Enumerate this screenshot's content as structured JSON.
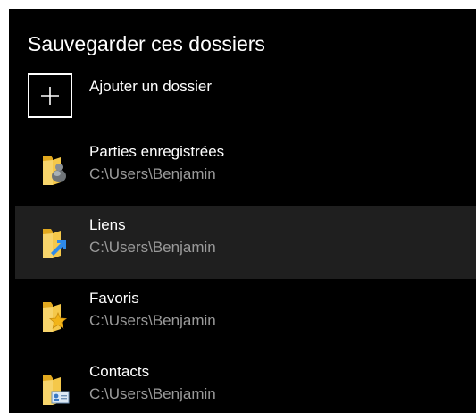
{
  "section": {
    "title": "Sauvegarder ces dossiers",
    "add_label": "Ajouter un dossier"
  },
  "folders": [
    {
      "name": "Parties enregistrées",
      "path": "C:\\Users\\Benjamin",
      "icon": "saved-games-folder-icon",
      "selected": false
    },
    {
      "name": "Liens",
      "path": "C:\\Users\\Benjamin",
      "icon": "links-folder-icon",
      "selected": true
    },
    {
      "name": "Favoris",
      "path": "C:\\Users\\Benjamin",
      "icon": "favorites-folder-icon",
      "selected": false
    },
    {
      "name": "Contacts",
      "path": "C:\\Users\\Benjamin",
      "icon": "contacts-folder-icon",
      "selected": false
    }
  ],
  "colors": {
    "background": "#000000",
    "selected_row": "#1f1f1f",
    "text": "#ffffff",
    "secondary_text": "#9a9a9a",
    "folder_yellow": "#f5c84a"
  }
}
